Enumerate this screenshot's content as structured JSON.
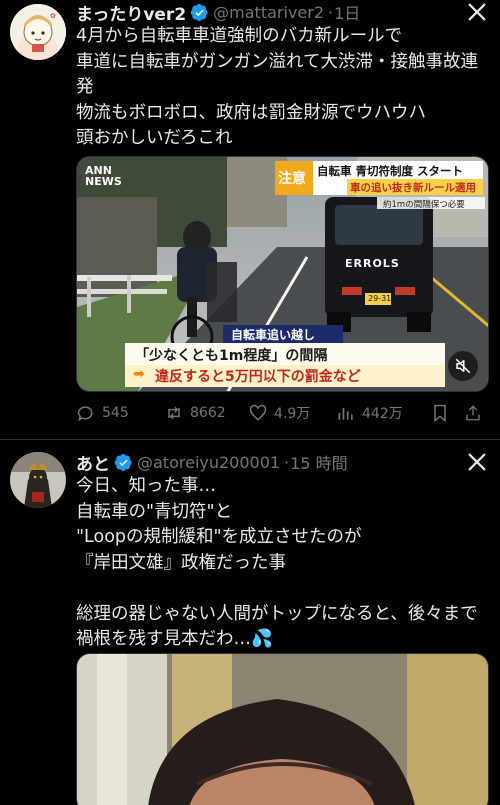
{
  "tweets": [
    {
      "display_name": "まったりver2",
      "handle": "@mattariver2",
      "time": "1日",
      "text": "4月から自転車車道強制のバカ新ルールで\n車道に自転車がガンガン溢れて大渋滞・接触事故連発\n物流もボロボロ、政府は罰金財源でウハウハ\n頭おかしいだろこれ",
      "video": {
        "logo": "ANN NEWS",
        "badge_top": "自転車 青切符制度 スタート",
        "badge_main": "車の追い抜き新ルール適用",
        "badge_tag": "注意",
        "small_note": "約1mの間隔保つ必要",
        "van_brand": "ERROLS",
        "plate": "29-31",
        "caption_head": "自転車追い越し",
        "caption_line1": "「少なくとも1m程度」の間隔",
        "caption_line2": "違反すると5万円以下の罰金など"
      },
      "stats": {
        "replies": "545",
        "retweets": "8662",
        "likes": "4.9万",
        "views": "442万"
      }
    },
    {
      "display_name": "あと",
      "handle": "@atoreiyu200001",
      "time": "15 時間",
      "text": "今日、知った事…\n自転車の\"青切符\"と\n\"Loopの規制緩和\"を成立させたのが\n『岸田文雄』政権だった事\n\n総理の器じゃない人間がトップになると、後々まで禍根を残す見本だわ…💦"
    }
  ],
  "colors": {
    "accent": "#1d9bf0",
    "muted": "#71767b",
    "text": "#e7e9ea",
    "background": "#000000"
  }
}
